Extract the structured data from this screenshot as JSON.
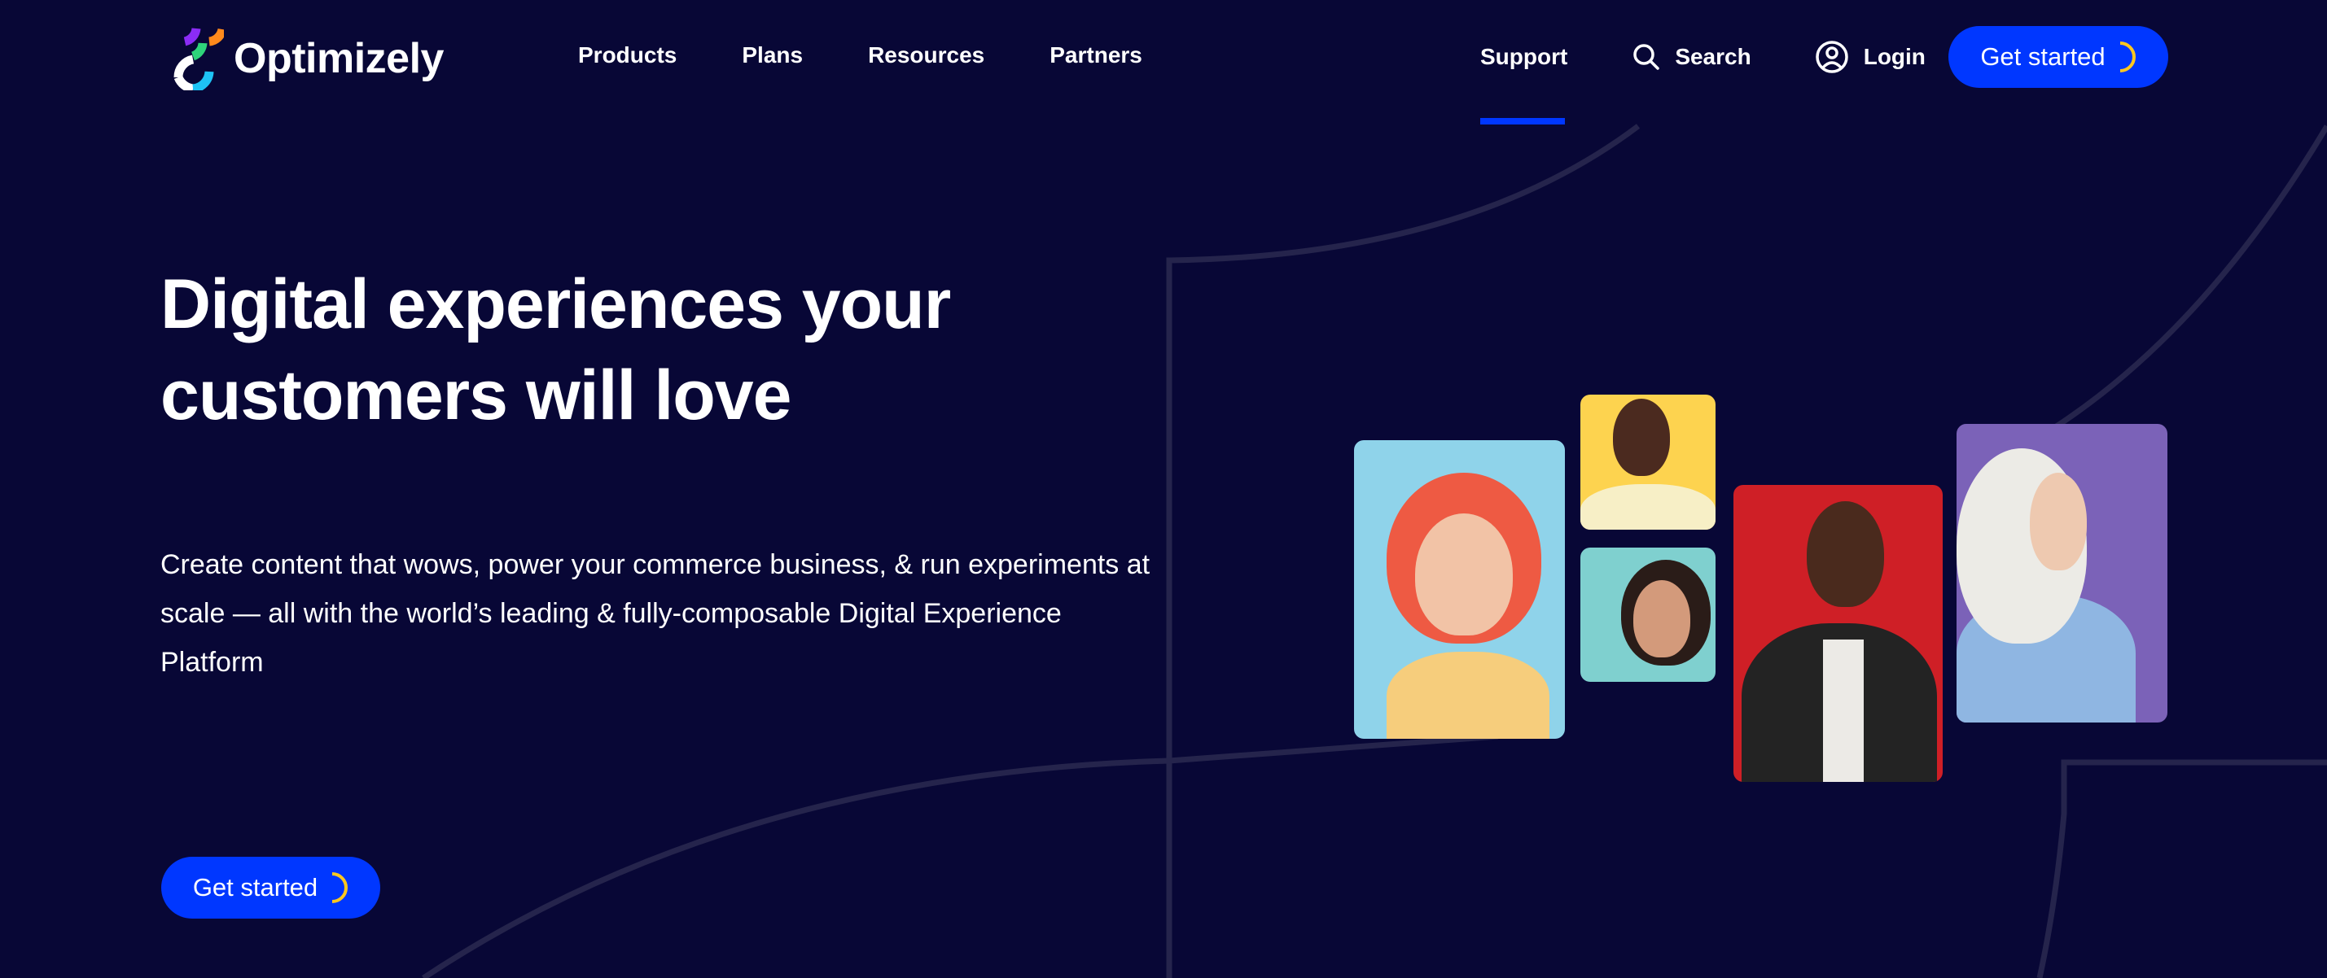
{
  "brand": {
    "name": "Optimizely"
  },
  "nav": {
    "items": [
      {
        "label": "Products"
      },
      {
        "label": "Plans"
      },
      {
        "label": "Resources"
      },
      {
        "label": "Partners"
      }
    ],
    "support_label": "Support",
    "search_label": "Search",
    "login_label": "Login",
    "cta_label": "Get started",
    "active_item": "Support"
  },
  "hero": {
    "title_line1": "Digital experiences your",
    "title_line2": "customers will love",
    "subtitle": "Create content that wows, power your commerce business, & run experiments at scale — all with the world’s leading & fully-composable Digital Experience Platform",
    "cta_label": "Get started"
  },
  "photos": [
    {
      "name": "woman-red-hair-smiling",
      "background": "#8fd3ea"
    },
    {
      "name": "woman-laughing-yellow",
      "background": "#fdd34f"
    },
    {
      "name": "woman-smiling-teal",
      "background": "#7fd0cf"
    },
    {
      "name": "man-laughing-red",
      "background": "#cf1f26"
    },
    {
      "name": "woman-hijab-purple",
      "background": "#7b62b8"
    }
  ],
  "colors": {
    "background": "#080736",
    "accent": "#0037ff",
    "accent_arc": "#ffc81e",
    "line": "#25244c"
  }
}
